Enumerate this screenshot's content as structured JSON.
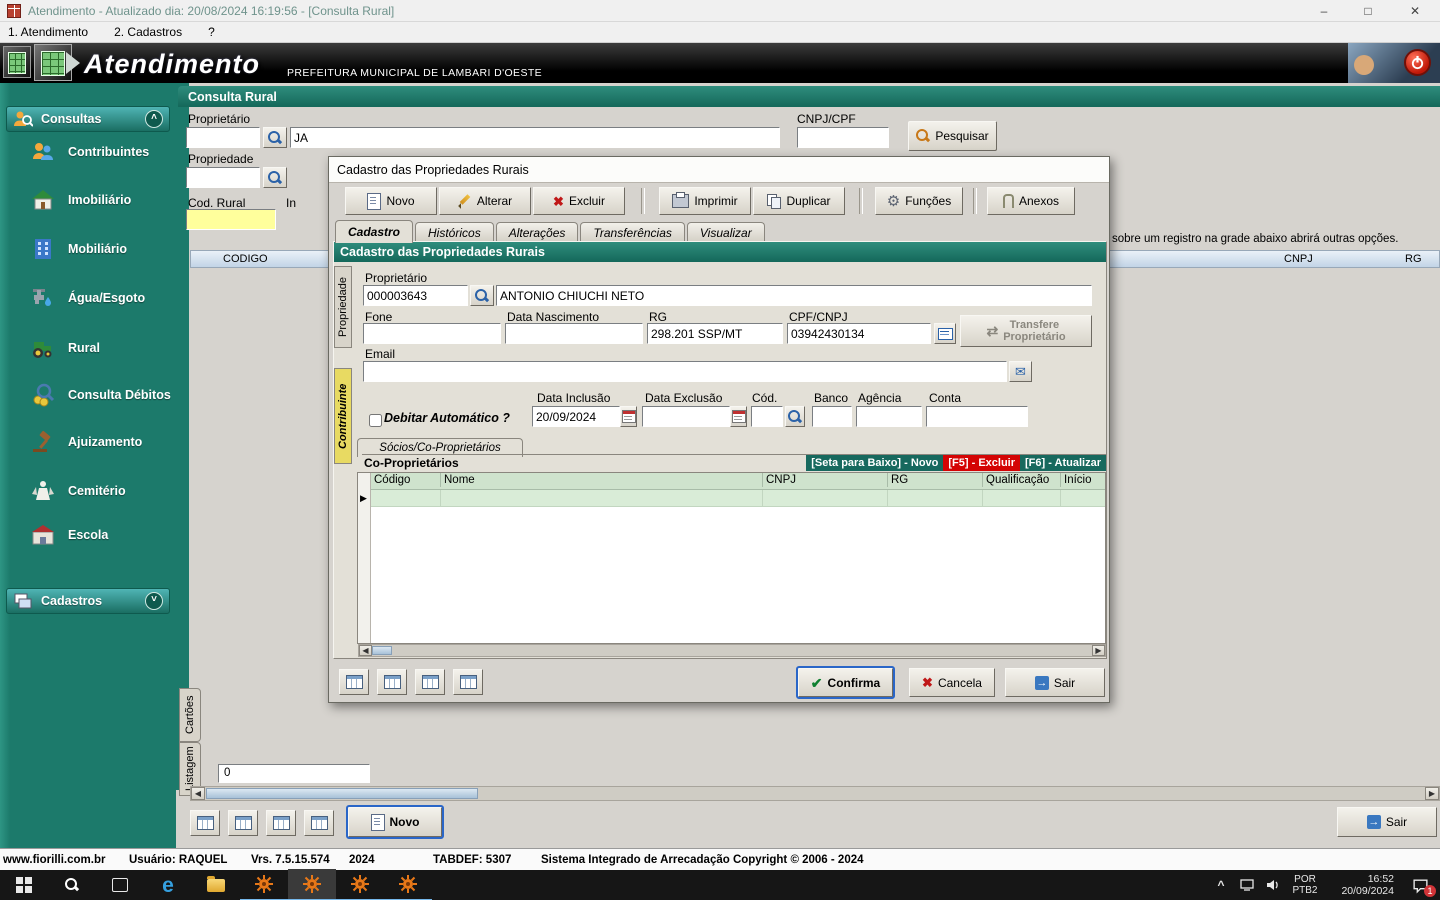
{
  "window": {
    "title": "Atendimento - Atualizado dia: 20/08/2024 16:19:56 - [Consulta Rural]"
  },
  "menu": {
    "items": [
      "1. Atendimento",
      "2. Cadastros",
      "?"
    ]
  },
  "banner": {
    "app_name": "Atendimento",
    "subtitle": "PREFEITURA MUNICIPAL DE LAMBARI D'OESTE"
  },
  "sidebar": {
    "consultas_label": "Consultas",
    "cadastros_label": "Cadastros",
    "items": [
      {
        "label": "Contribuintes"
      },
      {
        "label": "Imobiliário"
      },
      {
        "label": "Mobiliário"
      },
      {
        "label": "Água/Esgoto"
      },
      {
        "label": "Rural"
      },
      {
        "label": "Consulta Débitos"
      },
      {
        "label": "Ajuizamento"
      },
      {
        "label": "Cemitério"
      },
      {
        "label": "Escola"
      }
    ]
  },
  "main": {
    "title": "Consulta Rural",
    "proprietario_label": "Proprietário",
    "proprietario_name": "JA",
    "cnpj_label": "CNPJ/CPF",
    "pesquisar_label": "Pesquisar",
    "propriedade_label": "Propriedade",
    "cod_rural_label": "Cod. Rural",
    "inscricao_label": "In",
    "hint": "sobre um registro na grade abaixo abrirá outras opções.",
    "grid_headers": [
      "CODIGO",
      "CNPJ",
      "RG"
    ],
    "record_count": "0",
    "novo_label": "Novo",
    "sair_label": "Sair",
    "vtabs": {
      "cartoes": "Cartões",
      "listagem": "Listagem"
    }
  },
  "dialog": {
    "title": "Cadastro das Propriedades Rurais",
    "toolbar": [
      "Novo",
      "Alterar",
      "Excluir",
      "Imprimir",
      "Duplicar",
      "Funções",
      "Anexos"
    ],
    "tabs": [
      "Cadastro",
      "Históricos",
      "Alterações",
      "Transferências",
      "Visualizar"
    ],
    "section_title": "Cadastro das Propriedades Rurais",
    "vtabs": [
      "Propriedade",
      "Contribuinte"
    ],
    "fields": {
      "proprietario_label": "Proprietário",
      "proprietario_code": "000003643",
      "proprietario_name": "ANTONIO CHIUCHI NETO",
      "fone_label": "Fone",
      "data_nascimento_label": "Data Nascimento",
      "rg_label": "RG",
      "rg_value": "298.201 SSP/MT",
      "cpf_label": "CPF/CNPJ",
      "cpf_value": "03942430134",
      "transfere_line1": "Transfere",
      "transfere_line2": "Proprietário",
      "email_label": "Email",
      "debitar_label": "Debitar Automático ?",
      "data_inclusao_label": "Data Inclusão",
      "data_inclusao_value": "20/09/2024",
      "data_exclusao_label": "Data Exclusão",
      "cod_label": "Cód.",
      "banco_label": "Banco",
      "agencia_label": "Agência",
      "conta_label": "Conta"
    },
    "socios_tab_label": "Sócios/Co-Proprietários",
    "coprop": {
      "title": "Co-Proprietários",
      "hint_novo": "[Seta para Baixo] - Novo",
      "hint_excluir": "[F5] - Excluir",
      "hint_atualizar": "[F6] - Atualizar",
      "grid_headers": [
        "Código",
        "Nome",
        "CNPJ",
        "RG",
        "Qualificação",
        "Início"
      ]
    },
    "buttons": {
      "confirma": "Confirma",
      "cancela": "Cancela",
      "sair": "Sair"
    }
  },
  "statusbar": {
    "items": [
      "www.fiorilli.com.br",
      "Usuário: RAQUEL",
      "Vrs. 7.5.15.574",
      "2024",
      "TABDEF: 5307",
      "Sistema Integrado de Arrecadação Copyright © 2006 - 2024"
    ]
  },
  "taskbar": {
    "lang_top": "POR",
    "lang_bottom": "PTB2",
    "time": "16:52",
    "date": "20/09/2024",
    "badge": "1"
  }
}
